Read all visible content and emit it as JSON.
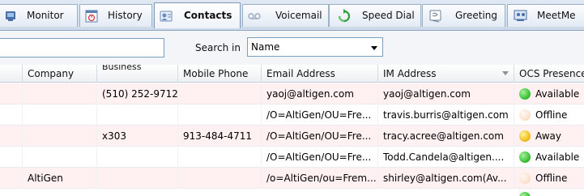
{
  "tabs": [
    {
      "label": "Monitor",
      "icon": "monitor-icon",
      "active": false
    },
    {
      "label": "History",
      "icon": "history-icon",
      "active": false
    },
    {
      "label": "Contacts",
      "icon": "contacts-icon",
      "active": true
    },
    {
      "label": "Voicemail",
      "icon": "voicemail-icon",
      "active": false
    },
    {
      "label": "Speed Dial",
      "icon": "speed-dial-icon",
      "active": false
    },
    {
      "label": "Greeting",
      "icon": "greeting-icon",
      "active": false
    },
    {
      "label": "MeetMe",
      "icon": "meetme-icon",
      "active": false
    }
  ],
  "search": {
    "value": "",
    "search_in_label": "Search in",
    "search_in_selected": "Name"
  },
  "columns": [
    "Company",
    "Business",
    "Mobile Phone",
    "Email Address",
    "IM Address",
    "OCS Presence"
  ],
  "rows": [
    {
      "company": "",
      "business": "(510) 252-9712",
      "mobile": "",
      "email": "yaoj@altigen.com",
      "im": "yaoj@altigen.com",
      "presence": "Available"
    },
    {
      "company": "",
      "business": "",
      "mobile": "",
      "email": "/O=AltiGen/OU=Fre...",
      "im": "travis.burris@altigen.com",
      "presence": "Offline"
    },
    {
      "company": "",
      "business": "x303",
      "mobile": "913-484-4711",
      "email": "/O=AltiGen/OU=Fre...",
      "im": "tracy.acree@altigen.com",
      "presence": "Away"
    },
    {
      "company": "",
      "business": "",
      "mobile": "",
      "email": "/O=AltiGen/OU=Fre...",
      "im": "Todd.Candela@altigen....",
      "presence": "Available"
    },
    {
      "company": "AltiGen",
      "business": "",
      "mobile": "",
      "email": "/o=AltiGen/ou=Frem...",
      "im": "shirley@altigen.com(Av...",
      "presence": "Offline"
    }
  ],
  "colors": {
    "available": "#3cc43a",
    "offline": "#fde3d0",
    "away": "#f2c21b",
    "alt_row": "#fff0f2"
  }
}
